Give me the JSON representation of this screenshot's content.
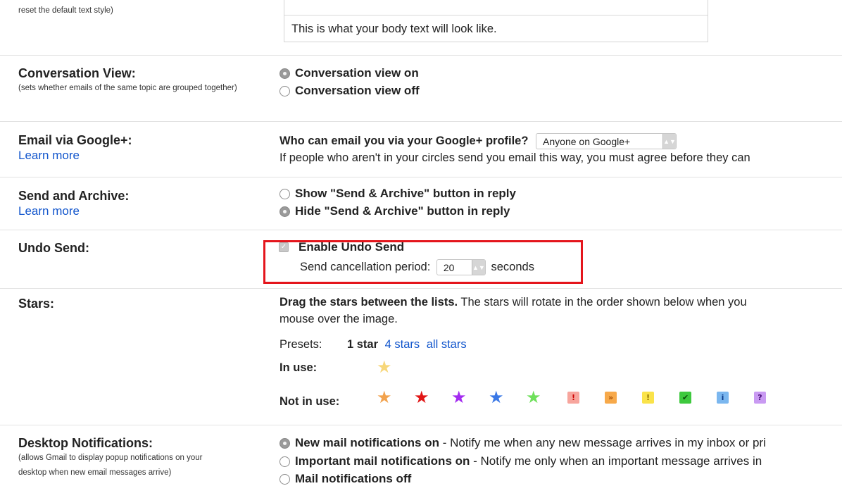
{
  "text_style": {
    "label_desc": "reset the default text style)",
    "preview": "This is what your body text will look like."
  },
  "conversation_view": {
    "title": "Conversation View:",
    "desc": "(sets whether emails of the same topic are grouped together)",
    "options": [
      "Conversation view on",
      "Conversation view off"
    ],
    "selected": 0
  },
  "email_via_gplus": {
    "title": "Email via Google+:",
    "link": "Learn more",
    "question": "Who can email you via your Google+ profile?",
    "select_value": "Anyone on Google+",
    "note": "If people who aren't in your circles send you email this way, you must agree before they can"
  },
  "send_archive": {
    "title": "Send and Archive:",
    "link": "Learn more",
    "options": [
      "Show \"Send & Archive\" button in reply",
      "Hide \"Send & Archive\" button in reply"
    ],
    "selected": 1
  },
  "undo_send": {
    "title": "Undo Send:",
    "checkbox_label": "Enable Undo Send",
    "checked": true,
    "period_label": "Send cancellation period:",
    "period_value": "20",
    "period_unit": "seconds"
  },
  "stars": {
    "title": "Stars:",
    "instruction_bold": "Drag the stars between the lists.",
    "instruction": "The stars will rotate in the order shown below when you",
    "instruction_line2": "mouse over the image.",
    "presets_label": "Presets:",
    "presets": [
      "1 star",
      "4 stars",
      "all stars"
    ],
    "in_use_label": "In use:",
    "not_in_use_label": "Not in use:",
    "in_use": [
      {
        "icon": "yellow-star-icon",
        "glyph": "★",
        "color": "#f7d77a"
      }
    ],
    "not_in_use_stars": [
      {
        "icon": "orange-star-icon",
        "glyph": "★",
        "color": "#f2a24d"
      },
      {
        "icon": "red-star-icon",
        "glyph": "★",
        "color": "#e11616"
      },
      {
        "icon": "purple-star-icon",
        "glyph": "★",
        "color": "#a32bf0"
      },
      {
        "icon": "blue-star-icon",
        "glyph": "★",
        "color": "#3a78e6"
      },
      {
        "icon": "green-star-icon",
        "glyph": "★",
        "color": "#6ee05a"
      }
    ],
    "not_in_use_marks": [
      {
        "icon": "red-bang-icon",
        "glyph": "!",
        "bg": "#f7a59d",
        "fg": "#c00"
      },
      {
        "icon": "orange-guillemet-icon",
        "glyph": "»",
        "bg": "#f7a94a",
        "fg": "#a24a00"
      },
      {
        "icon": "yellow-bang-icon",
        "glyph": "!",
        "bg": "#fae34a",
        "fg": "#8a6d00"
      },
      {
        "icon": "green-check-icon",
        "glyph": "✔",
        "bg": "#3ec93e",
        "fg": "#0a4d0a"
      },
      {
        "icon": "blue-info-icon",
        "glyph": "i",
        "bg": "#7bb7ef",
        "fg": "#0a3a8a"
      },
      {
        "icon": "purple-question-icon",
        "glyph": "?",
        "bg": "#c99af2",
        "fg": "#4a0d7a"
      }
    ]
  },
  "desktop_notifications": {
    "title": "Desktop Notifications:",
    "desc": "(allows Gmail to display popup notifications on your desktop when new email messages arrive)",
    "options": [
      {
        "bold": "New mail notifications on",
        "rest": " - Notify me when any new message arrives in my inbox or pri"
      },
      {
        "bold": "Important mail notifications on",
        "rest": " - Notify me only when an important message arrives in"
      },
      {
        "bold": "Mail notifications off",
        "rest": ""
      }
    ],
    "selected": 0
  }
}
